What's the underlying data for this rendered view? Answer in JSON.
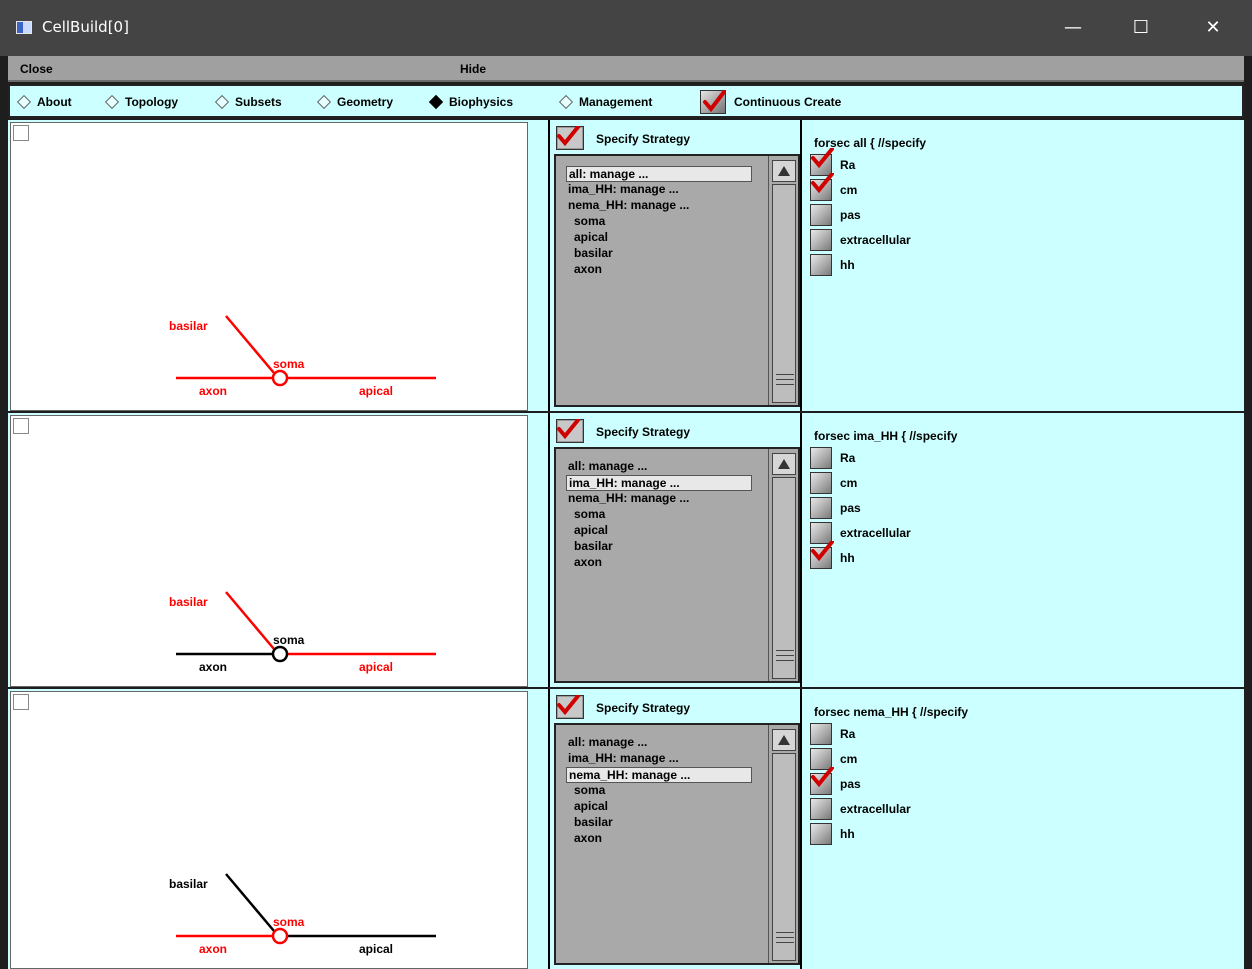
{
  "window": {
    "title": "CellBuild[0]"
  },
  "menubar": {
    "close": "Close",
    "hide": "Hide"
  },
  "tabs": [
    {
      "label": "About",
      "selected": false
    },
    {
      "label": "Topology",
      "selected": false
    },
    {
      "label": "Subsets",
      "selected": false
    },
    {
      "label": "Geometry",
      "selected": false
    },
    {
      "label": "Biophysics",
      "selected": true
    },
    {
      "label": "Management",
      "selected": false
    }
  ],
  "continuous_create": {
    "label": "Continuous Create",
    "checked": true
  },
  "colors": {
    "panel_bg": "#ccffff",
    "highlight": "#ff0000",
    "list_bg": "#a9a9a9",
    "titlebar": "#444444"
  },
  "panels": [
    {
      "shape_labels": {
        "basilar": "basilar",
        "soma": "soma",
        "axon": "axon",
        "apical": "apical"
      },
      "highlight": {
        "basilar": true,
        "soma": true,
        "axon": true,
        "apical": true
      },
      "specify_label": "Specify Strategy",
      "list": [
        "all:   manage ...",
        "ima_HH:   manage ...",
        "nema_HH:   manage ...",
        "soma",
        "apical",
        "basilar",
        "axon"
      ],
      "selected": 0,
      "forsec": "forsec all { //specify",
      "mechanisms": [
        {
          "label": "Ra",
          "checked": true
        },
        {
          "label": "cm",
          "checked": true
        },
        {
          "label": "pas",
          "checked": false
        },
        {
          "label": "extracellular",
          "checked": false
        },
        {
          "label": "hh",
          "checked": false
        }
      ]
    },
    {
      "shape_labels": {
        "basilar": "basilar",
        "soma": "soma",
        "axon": "axon",
        "apical": "apical"
      },
      "highlight": {
        "basilar": true,
        "soma": false,
        "axon": false,
        "apical": true
      },
      "specify_label": "Specify Strategy",
      "list": [
        "all:   manage ...",
        "ima_HH:   manage ...",
        "nema_HH:   manage ...",
        "soma",
        "apical",
        "basilar",
        "axon"
      ],
      "selected": 1,
      "forsec": "forsec ima_HH { //specify",
      "mechanisms": [
        {
          "label": "Ra",
          "checked": false
        },
        {
          "label": "cm",
          "checked": false
        },
        {
          "label": "pas",
          "checked": false
        },
        {
          "label": "extracellular",
          "checked": false
        },
        {
          "label": "hh",
          "checked": true
        }
      ]
    },
    {
      "shape_labels": {
        "basilar": "basilar",
        "soma": "soma",
        "axon": "axon",
        "apical": "apical"
      },
      "highlight": {
        "basilar": false,
        "soma": true,
        "axon": true,
        "apical": false
      },
      "specify_label": "Specify Strategy",
      "list": [
        "all:   manage ...",
        "ima_HH:   manage ...",
        "nema_HH:   manage ...",
        "soma",
        "apical",
        "basilar",
        "axon"
      ],
      "selected": 2,
      "forsec": "forsec nema_HH { //specify",
      "mechanisms": [
        {
          "label": "Ra",
          "checked": false
        },
        {
          "label": "cm",
          "checked": false
        },
        {
          "label": "pas",
          "checked": true
        },
        {
          "label": "extracellular",
          "checked": false
        },
        {
          "label": "hh",
          "checked": false
        }
      ]
    }
  ]
}
